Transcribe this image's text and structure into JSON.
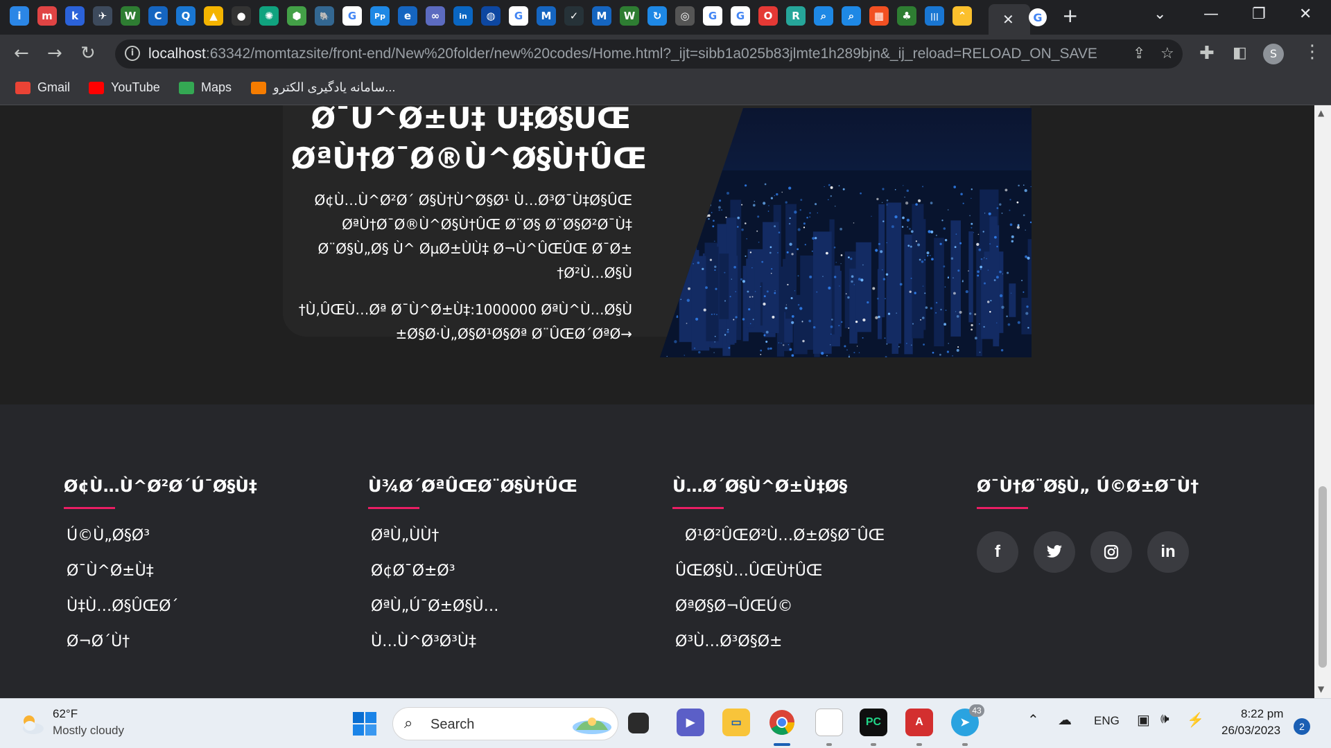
{
  "browser": {
    "tab_favicons": [
      {
        "name": "jetbrains-toolbox-favicon",
        "glyph": "i",
        "color": "#2b86e6"
      },
      {
        "name": "ted-favicon",
        "glyph": "m",
        "color": "#e04444"
      },
      {
        "name": "k-favicon",
        "glyph": "k",
        "color": "#2b62d9"
      },
      {
        "name": "paper-plane-favicon",
        "glyph": "✈",
        "color": "#3d4a5c"
      },
      {
        "name": "w-favicon",
        "glyph": "W",
        "color": "#2e7d32"
      },
      {
        "name": "c-favicon",
        "glyph": "C",
        "color": "#1565c0"
      },
      {
        "name": "q-favicon",
        "glyph": "Q",
        "color": "#1976d2"
      },
      {
        "name": "drive-favicon",
        "glyph": "▲",
        "color": "#f4b400"
      },
      {
        "name": "github-favicon",
        "glyph": "●",
        "color": "#333"
      },
      {
        "name": "chatgpt-favicon",
        "glyph": "✺",
        "color": "#10a37f"
      },
      {
        "name": "hex-favicon",
        "glyph": "⬢",
        "color": "#43a047"
      },
      {
        "name": "postgres-favicon",
        "glyph": "🐘",
        "color": "#336791"
      },
      {
        "name": "google-favicon-1",
        "glyph": "G",
        "color": "#ffffff"
      },
      {
        "name": "pp-favicon",
        "glyph": "Pp",
        "color": "#1e88e5"
      },
      {
        "name": "e-favicon",
        "glyph": "e",
        "color": "#1565c0"
      },
      {
        "name": "link-favicon",
        "glyph": "∞",
        "color": "#5c6bc0"
      },
      {
        "name": "linkedin-favicon",
        "glyph": "in",
        "color": "#0a66c2"
      },
      {
        "name": "globe-blue-favicon",
        "glyph": "◍",
        "color": "#0d47a1"
      },
      {
        "name": "google-favicon-2",
        "glyph": "G",
        "color": "#ffffff"
      },
      {
        "name": "mql5-favicon-1",
        "glyph": "M",
        "color": "#1565c0"
      },
      {
        "name": "check-favicon",
        "glyph": "✓",
        "color": "#263238"
      },
      {
        "name": "mql5-favicon-2",
        "glyph": "M",
        "color": "#1565c0"
      },
      {
        "name": "w-favicon-2",
        "glyph": "W",
        "color": "#2e7d32"
      },
      {
        "name": "refresh-favicon",
        "glyph": "↻",
        "color": "#1e88e5"
      },
      {
        "name": "globe-favicon",
        "glyph": "◎",
        "color": "#555"
      },
      {
        "name": "google-favicon-3",
        "glyph": "G",
        "color": "#ffffff"
      },
      {
        "name": "google-favicon-4",
        "glyph": "G",
        "color": "#ffffff"
      },
      {
        "name": "opera-favicon",
        "glyph": "O",
        "color": "#e53935"
      },
      {
        "name": "pycharm-favicon",
        "glyph": "R",
        "color": "#26a69a"
      },
      {
        "name": "search-favicon-1",
        "glyph": "⌕",
        "color": "#1e88e5"
      },
      {
        "name": "search-favicon-2",
        "glyph": "⌕",
        "color": "#1e88e5"
      },
      {
        "name": "microsoft-favicon",
        "glyph": "▦",
        "color": "#f25022"
      },
      {
        "name": "tree-favicon",
        "glyph": "♣",
        "color": "#2e7d32"
      },
      {
        "name": "bars-favicon",
        "glyph": "|||",
        "color": "#1976d2"
      },
      {
        "name": "arrow-favicon",
        "glyph": "⌃",
        "color": "#fbc02d"
      }
    ],
    "active_tab_favicon": "G",
    "url_host": "localhost",
    "url_rest": ":63342/momtazsite/front-end/New%20folder/new%20codes/Home.html?_ijt=sibb1a025b83jlmte1h289bjn&_ij_reload=RELOAD_ON_SAVE",
    "profile_initial": "S",
    "bookmarks": [
      {
        "label": "Gmail",
        "color": "#ea4335"
      },
      {
        "label": "YouTube",
        "color": "#ff0000"
      },
      {
        "label": "Maps",
        "color": "#34a853"
      },
      {
        "label": "سامانه یادگیری الکترو...",
        "color": "#f57c00"
      }
    ]
  },
  "hero": {
    "title_line1": "Ø¯Ù^Ø±Ù‡ Ù‡Ø§ÛŒ",
    "title_line2": "ØªÙ†Ø¯Ø®Ù^Ø§Ù†ÛŒ",
    "desc_line1": "Ø¢Ù…Ù^Ø²Ø´ Ø§Ù†Ù^Ø§Ø¹ Ù…Ø³Ø¯Ù‡Ø§ÛŒ",
    "desc_line2": "ØªÙ†Ø¯Ø®Ù^Ø§Ù†ÛŒ Ø¨Ø§ Ø¨Ø§Ø²Ø¯Ù‡",
    "desc_line3": "Ø¨Ø§Ù„Ø§ Ù^ ØµØ±ÙÙ‡ Ø¬Ù^ÛŒÛŒ Ø¯Ø±",
    "desc_line4": "†Ø²Ù…Ø§Ù",
    "stat_line1": "†Ù‚ÛŒÙ…Øª Ø¯Ù^Ø±Ù‡:1000000 ØªÙ^Ù…Ø§Ù",
    "stat_line2": "±Ø§Ø·Ù„Ø§Ø¹Ø§Øª Ø¨ÛŒØ´ØªØ→"
  },
  "footer": {
    "columns": [
      {
        "heading": "Ø¢Ù…Ù^Ø²Ø´Ú¯Ø§Ù‡",
        "links": [
          "Ú©Ù„Ø§Ø³",
          "Ø¯Ù^Ø±Ù‡",
          "Ù‡Ù…Ø§ÛŒØ´",
          "Ø¬Ø´Ù†"
        ]
      },
      {
        "heading": "Ù¾Ø´ØªÛŒØ¨Ø§Ù†ÛŒ",
        "links": [
          "ØªÙ„ÙÙ†",
          "Ø¢Ø¯Ø±Ø³",
          "ØªÙ„Ú¯Ø±Ø§Ù…",
          "Ù…Ù^Ø³Ø³Ù‡"
        ]
      },
      {
        "heading": "Ù…Ø´Ø§Ù^Ø±Ù‡Ø§",
        "links": [
          "  Ø¹Ø²ÛŒØ²Ù…Ø±Ø§Ø¯ÛŒ",
          "ÛŒØ§Ù…ÛŒÙ†ÛŒ",
          "ØªØ§Ø¬ÛŒÚ©",
          "Ø³Ù…Ø³Ø§Ø±"
        ]
      },
      {
        "heading": "Ø¯Ù†Ø¨Ø§Ù„ Ú©Ø±Ø¯Ù†",
        "socials": [
          {
            "name": "facebook",
            "glyph": "f"
          },
          {
            "name": "twitter",
            "glyph": "🐦"
          },
          {
            "name": "instagram",
            "glyph": "◎"
          },
          {
            "name": "linkedin",
            "glyph": "in"
          }
        ]
      }
    ]
  },
  "taskbar": {
    "weather_temp": "62°F",
    "weather_desc": "Mostly cloudy",
    "search_placeholder": "Search",
    "lang": "ENG",
    "time": "8:22 pm",
    "date": "26/03/2023",
    "notification_count": "2",
    "telegram_badge": "43"
  }
}
